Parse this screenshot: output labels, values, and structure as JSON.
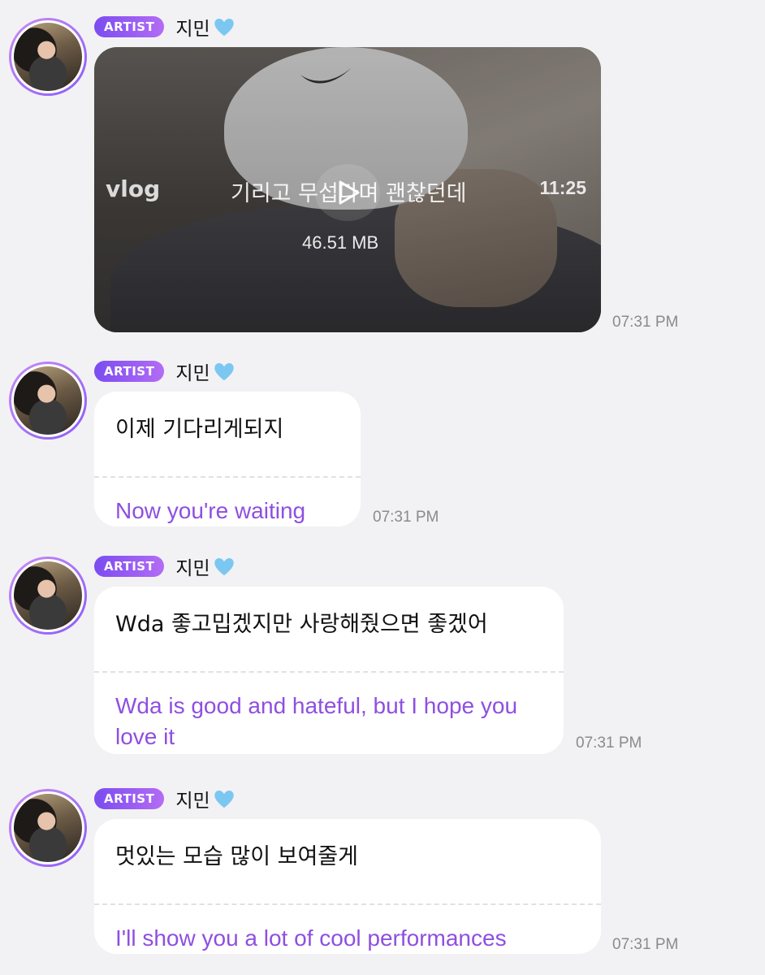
{
  "messages": [
    {
      "badge": "ARTIST",
      "name": "지민",
      "type": "video",
      "video": {
        "label": "vlog",
        "title": "기리고 무섭다며 괜찮던데",
        "duration": "11:25",
        "size": "46.51 MB"
      },
      "time": "07:31 PM"
    },
    {
      "badge": "ARTIST",
      "name": "지민",
      "type": "text",
      "original": "이제 기다리게되지",
      "translation": "Now you're waiting",
      "time": "07:31 PM"
    },
    {
      "badge": "ARTIST",
      "name": "지민",
      "type": "text",
      "original": "Wda 좋고밉겠지만 사랑해줬으면 좋겠어",
      "translation": "Wda is good and hateful, but I hope you love it",
      "time": "07:31 PM"
    },
    {
      "badge": "ARTIST",
      "name": "지민",
      "type": "text",
      "original": "멋있는 모습 많이 보여줄게",
      "translation": "I'll show you a lot of cool performances",
      "time": "07:31 PM"
    }
  ],
  "colors": {
    "background": "#f2f2f4",
    "badge_start": "#7b4cf0",
    "badge_end": "#b36cf5",
    "translation_text": "#8e4fe0",
    "timestamp": "#8a8a8f",
    "heart": "#7cc7f2"
  },
  "icons": {
    "heart": "light-blue-heart-emoji",
    "play": "play-icon"
  }
}
